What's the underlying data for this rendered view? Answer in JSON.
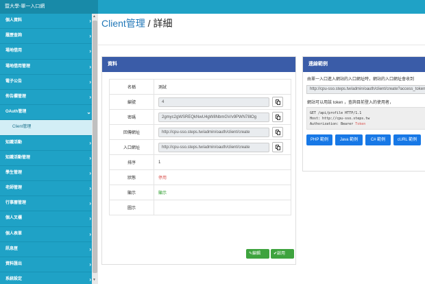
{
  "header": {
    "brand": "暨大學-單一入口網"
  },
  "sidebar": {
    "items": [
      {
        "label": "個人資料",
        "chevron": "›"
      },
      {
        "label": "履歷查詢",
        "chevron": "›"
      },
      {
        "label": "場地借用",
        "chevron": "›"
      },
      {
        "label": "場地借用管理",
        "chevron": "›"
      },
      {
        "label": "電子公告",
        "chevron": "›"
      },
      {
        "label": "佈告欄管理",
        "chevron": "›"
      },
      {
        "label": "OAuth管理",
        "chevron": "⌄"
      },
      {
        "label": "Client管理",
        "chevron": ""
      },
      {
        "label": "知識活動",
        "chevron": "›"
      },
      {
        "label": "知識活動管理",
        "chevron": "›"
      },
      {
        "label": "學生管理",
        "chevron": "›"
      },
      {
        "label": "老師管理",
        "chevron": "›"
      },
      {
        "label": "行事曆管理",
        "chevron": "›"
      },
      {
        "label": "個人叉櫃",
        "chevron": "›"
      },
      {
        "label": "個人表單",
        "chevron": "›"
      },
      {
        "label": "訊息匣",
        "chevron": "›"
      },
      {
        "label": "資料匯出",
        "chevron": "›"
      },
      {
        "label": "系統設定",
        "chevron": "›"
      }
    ]
  },
  "page": {
    "title_part1": "Client管理",
    "title_sep": " / ",
    "title_part2": "詳細"
  },
  "info_panel": {
    "heading": "資料",
    "rows": [
      {
        "label": "名稱",
        "value": "測試"
      },
      {
        "label": "編號",
        "value": "4"
      },
      {
        "label": "密碼",
        "value": "2gmyc2gWSREQkNwU4gW8NbmGV/v9PWN78lOg"
      },
      {
        "label": "回傳網址",
        "value": "http://cpu-sso.steps.tw/admin/oauth/client/create"
      },
      {
        "label": "入口網址",
        "value": "http://cpu-sso.steps.tw/admin/oauth/client/create"
      },
      {
        "label": "排序",
        "value": "1"
      },
      {
        "label": "狀態",
        "value": "停用"
      },
      {
        "label": "顯示",
        "value": "顯示"
      },
      {
        "label": "圖示",
        "value": ""
      }
    ],
    "edit_label": "編輯",
    "enable_label": "啟用"
  },
  "connect_panel": {
    "heading": "連線範例",
    "desc1": "由單一入口進入網站的入口網址時，網站的入口網址會收到",
    "url": "http://cpu-sso.steps.tw/admin/oauth/client/create?access_token=",
    "desc2": "網站可以用該 token ，查詢目前登入的使用者，",
    "code_line1": "GET /api/profile HTTP/1.1",
    "code_line2": "Host: http://cpu-sso.steps.tw",
    "code_line3_prefix": "Authorization: Bearer ",
    "code_line3_token": "Token",
    "buttons": [
      "PHP 範例",
      "Java 範例",
      "C# 範例",
      "cURL 範例"
    ]
  },
  "colors": {
    "sidebar": "#1fa2c6",
    "panel_header": "#3a5ca8",
    "button_green": "#3ea33e",
    "button_blue": "#1778e6"
  }
}
